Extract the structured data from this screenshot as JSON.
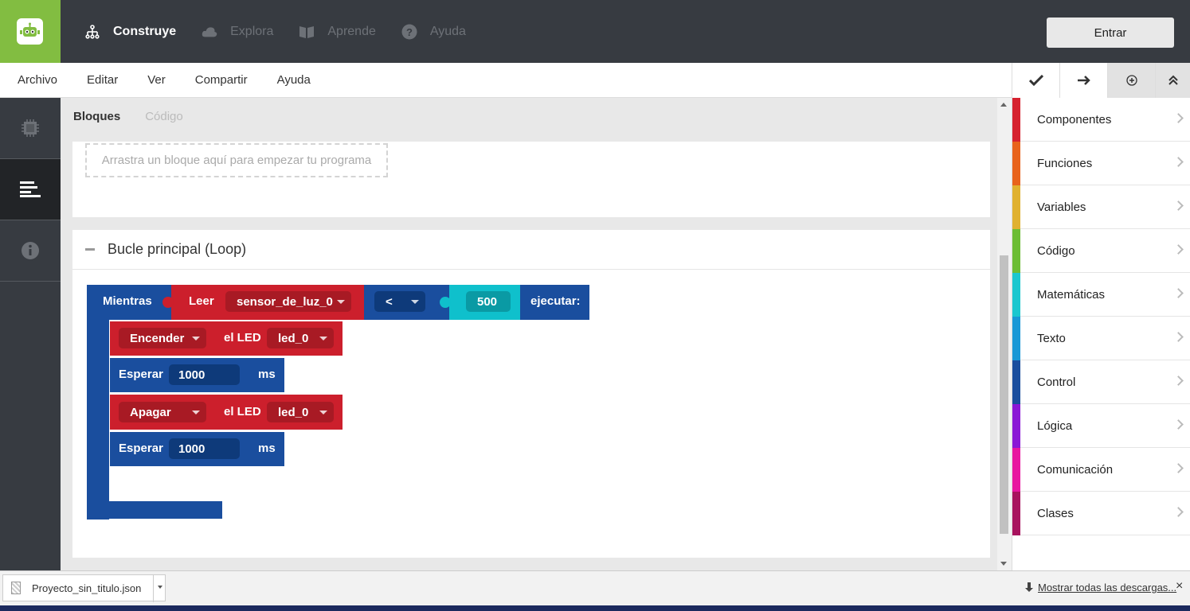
{
  "topbar": {
    "nav": [
      {
        "label": "Construye",
        "icon": "sitemap-icon",
        "active": true
      },
      {
        "label": "Explora",
        "icon": "cloud-icon",
        "active": false
      },
      {
        "label": "Aprende",
        "icon": "book-icon",
        "active": false
      },
      {
        "label": "Ayuda",
        "icon": "question-icon",
        "active": false
      }
    ],
    "login_label": "Entrar"
  },
  "menubar": {
    "items": [
      "Archivo",
      "Editar",
      "Ver",
      "Compartir",
      "Ayuda"
    ]
  },
  "workspace": {
    "tabs": [
      {
        "label": "Bloques",
        "active": true
      },
      {
        "label": "Código",
        "active": false
      }
    ],
    "dropzone_text": "Arrastra un bloque aquí para empezar tu programa",
    "loop_title": "Bucle principal (Loop)",
    "blocks": {
      "while_label": "Mientras",
      "read_label": "Leer",
      "sensor_value": "sensor_de_luz_0",
      "operator_value": "<",
      "number_value": "500",
      "execute_label": "ejecutar:",
      "on_value": "Encender",
      "led_label_1": "el LED",
      "led_value_1": "led_0",
      "wait_label_1": "Esperar",
      "wait_value_1": "1000",
      "ms_label_1": "ms",
      "off_value": "Apagar",
      "led_label_2": "el LED",
      "led_value_2": "led_0",
      "wait_label_2": "Esperar",
      "wait_value_2": "1000",
      "ms_label_2": "ms"
    }
  },
  "categories": [
    {
      "label": "Componentes",
      "color": "#d6212f"
    },
    {
      "label": "Funciones",
      "color": "#e8631c"
    },
    {
      "label": "Variables",
      "color": "#e0b130"
    },
    {
      "label": "Código",
      "color": "#6cbd35"
    },
    {
      "label": "Matemáticas",
      "color": "#1bc7cf"
    },
    {
      "label": "Texto",
      "color": "#1998d6"
    },
    {
      "label": "Control",
      "color": "#1a4e9e"
    },
    {
      "label": "Lógica",
      "color": "#8b17d6"
    },
    {
      "label": "Comunicación",
      "color": "#e816a0"
    },
    {
      "label": "Clases",
      "color": "#a8135e"
    }
  ],
  "downloads": {
    "file_name": "Proyecto_sin_titulo.json",
    "show_all_label": "Mostrar todas las descargas...",
    "close_symbol": "×"
  },
  "colors": {
    "topbar": "#373b41",
    "brand_green": "#82bd41",
    "block_blue": "#1a4e9e",
    "block_red": "#cc1f2c",
    "block_teal": "#0fc0cc"
  }
}
